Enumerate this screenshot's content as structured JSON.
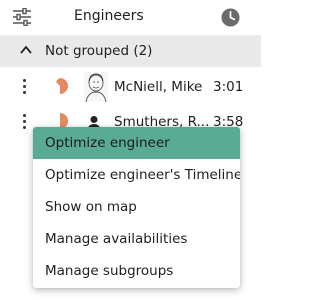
{
  "header": {
    "title": "Engineers",
    "filter_icon": "filter-sliders-icon",
    "clock_icon": "clock-icon"
  },
  "group": {
    "label": "Not grouped (2)",
    "expanded": true
  },
  "engineers": [
    {
      "name": "McNiell, Mike",
      "time": "3:01",
      "avatar": "portrait-sketch"
    },
    {
      "name": "Smuthers, R...",
      "time": "3:58",
      "avatar": "person-icon"
    }
  ],
  "context_menu": {
    "items": [
      {
        "label": "Optimize engineer",
        "highlighted": true
      },
      {
        "label": "Optimize engineer's Timeline",
        "highlighted": false
      },
      {
        "label": "Show on map",
        "highlighted": false
      },
      {
        "label": "Manage availabilities",
        "highlighted": false
      },
      {
        "label": "Manage subgroups",
        "highlighted": false
      }
    ]
  },
  "colors": {
    "highlight": "#5aab93",
    "pie_accent": "#e58a5e",
    "group_bg": "#e9e9e9"
  }
}
